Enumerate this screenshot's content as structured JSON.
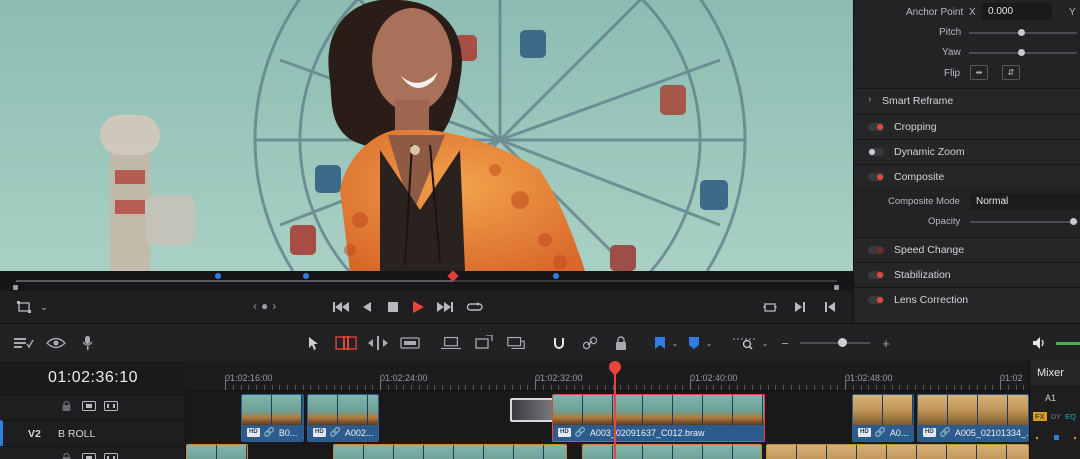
{
  "colors": {
    "accent": "#e8463c",
    "blue": "#2f7de1",
    "clip_blue": "#2b5c8d",
    "clip_orange": "#c98a3a"
  },
  "inspector": {
    "anchor_point": {
      "label": "Anchor Point",
      "x_label": "X",
      "x_value": "0.000",
      "y_label": "Y"
    },
    "pitch_label": "Pitch",
    "yaw_label": "Yaw",
    "flip_label": "Flip",
    "sections": [
      {
        "name": "Smart Reframe",
        "kind": "chevron"
      },
      {
        "name": "Cropping",
        "kind": "toggle-on"
      },
      {
        "name": "Dynamic Zoom",
        "kind": "toggle-off"
      },
      {
        "name": "Composite",
        "kind": "toggle-on"
      },
      {
        "name": "Speed Change",
        "kind": "toggle-dim"
      },
      {
        "name": "Stabilization",
        "kind": "toggle-on"
      },
      {
        "name": "Lens Correction",
        "kind": "toggle-on"
      }
    ],
    "composite_mode_label": "Composite Mode",
    "composite_mode_value": "Normal",
    "opacity_label": "Opacity"
  },
  "transport": {
    "icons": [
      "transform-icon",
      "dropdown-icon",
      "prev-edit-icon",
      "next-edit-icon",
      "jump-start-icon",
      "step-back-icon",
      "stop-icon",
      "play-icon",
      "jump-end-icon",
      "loop-icon",
      "fullscreen-icon",
      "next-clip-icon",
      "prev-clip-icon"
    ]
  },
  "timeline": {
    "timecode": "01:02:36:10",
    "tracks": [
      {
        "id": "",
        "name": ""
      },
      {
        "id": "V2",
        "name": "B ROLL"
      }
    ],
    "ruler_labels": [
      "01:02:16:00",
      "01:02:24:00",
      "01:02:32:00",
      "01:02:40:00",
      "01:02:48:00",
      "01:02"
    ],
    "clips_v2": [
      {
        "label": "B0..."
      },
      {
        "label": "A002..."
      },
      {
        "label": "A003_02091637_C012.braw"
      },
      {
        "label": "A0..."
      },
      {
        "label": "A005_02101334_..."
      }
    ],
    "clip_badge": "HD"
  },
  "mixer": {
    "title": "Mixer",
    "channel": "A1",
    "fx": "FX",
    "dy": "DY",
    "eq": "EQ"
  }
}
